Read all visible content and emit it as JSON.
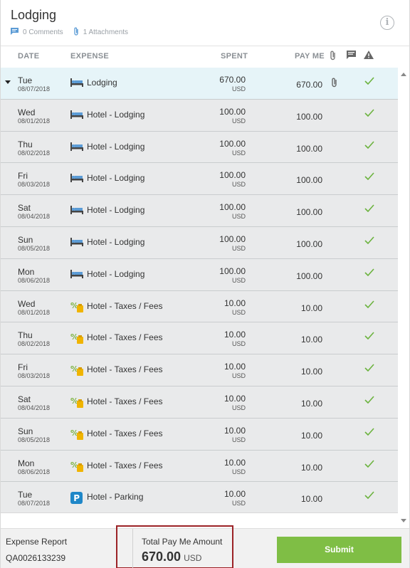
{
  "header": {
    "title": "Lodging",
    "comments": "0 Comments",
    "attachments": "1 Attachments"
  },
  "columns": {
    "date": "DATE",
    "expense": "EXPENSE",
    "spent": "SPENT",
    "pay_me": "PAY ME"
  },
  "rows": [
    {
      "day": "Tue",
      "date": "08/07/2018",
      "icon": "bed-icon",
      "expense": "Lodging",
      "spent": "670.00",
      "currency": "USD",
      "pay": "670.00"
    },
    {
      "day": "Wed",
      "date": "08/01/2018",
      "icon": "bed-icon",
      "expense": "Hotel - Lodging",
      "spent": "100.00",
      "currency": "USD",
      "pay": "100.00"
    },
    {
      "day": "Thu",
      "date": "08/02/2018",
      "icon": "bed-icon",
      "expense": "Hotel - Lodging",
      "spent": "100.00",
      "currency": "USD",
      "pay": "100.00"
    },
    {
      "day": "Fri",
      "date": "08/03/2018",
      "icon": "bed-icon",
      "expense": "Hotel - Lodging",
      "spent": "100.00",
      "currency": "USD",
      "pay": "100.00"
    },
    {
      "day": "Sat",
      "date": "08/04/2018",
      "icon": "bed-icon",
      "expense": "Hotel - Lodging",
      "spent": "100.00",
      "currency": "USD",
      "pay": "100.00"
    },
    {
      "day": "Sun",
      "date": "08/05/2018",
      "icon": "bed-icon",
      "expense": "Hotel - Lodging",
      "spent": "100.00",
      "currency": "USD",
      "pay": "100.00"
    },
    {
      "day": "Mon",
      "date": "08/06/2018",
      "icon": "bed-icon",
      "expense": "Hotel - Lodging",
      "spent": "100.00",
      "currency": "USD",
      "pay": "100.00"
    },
    {
      "day": "Wed",
      "date": "08/01/2018",
      "icon": "tax-fee-icon",
      "expense": "Hotel - Taxes / Fees",
      "spent": "10.00",
      "currency": "USD",
      "pay": "10.00"
    },
    {
      "day": "Thu",
      "date": "08/02/2018",
      "icon": "tax-fee-icon",
      "expense": "Hotel - Taxes / Fees",
      "spent": "10.00",
      "currency": "USD",
      "pay": "10.00"
    },
    {
      "day": "Fri",
      "date": "08/03/2018",
      "icon": "tax-fee-icon",
      "expense": "Hotel - Taxes / Fees",
      "spent": "10.00",
      "currency": "USD",
      "pay": "10.00"
    },
    {
      "day": "Sat",
      "date": "08/04/2018",
      "icon": "tax-fee-icon",
      "expense": "Hotel - Taxes / Fees",
      "spent": "10.00",
      "currency": "USD",
      "pay": "10.00"
    },
    {
      "day": "Sun",
      "date": "08/05/2018",
      "icon": "tax-fee-icon",
      "expense": "Hotel - Taxes / Fees",
      "spent": "10.00",
      "currency": "USD",
      "pay": "10.00"
    },
    {
      "day": "Mon",
      "date": "08/06/2018",
      "icon": "tax-fee-icon",
      "expense": "Hotel - Taxes / Fees",
      "spent": "10.00",
      "currency": "USD",
      "pay": "10.00"
    },
    {
      "day": "Tue",
      "date": "08/07/2018",
      "icon": "parking-icon",
      "expense": "Hotel - Parking",
      "spent": "10.00",
      "currency": "USD",
      "pay": "10.00"
    }
  ],
  "footer": {
    "report_label": "Expense Report",
    "report_number": "QA0026133239",
    "total_label": "Total Pay Me Amount",
    "total_value": "670.00",
    "total_currency": "USD",
    "submit_label": "Submit"
  },
  "colors": {
    "accent_blue": "#5b9bd5",
    "check_green": "#6cb33f",
    "submit_green": "#7fbe45",
    "highlight_red": "#9b2226",
    "parent_row_bg": "#e6f4f8"
  }
}
